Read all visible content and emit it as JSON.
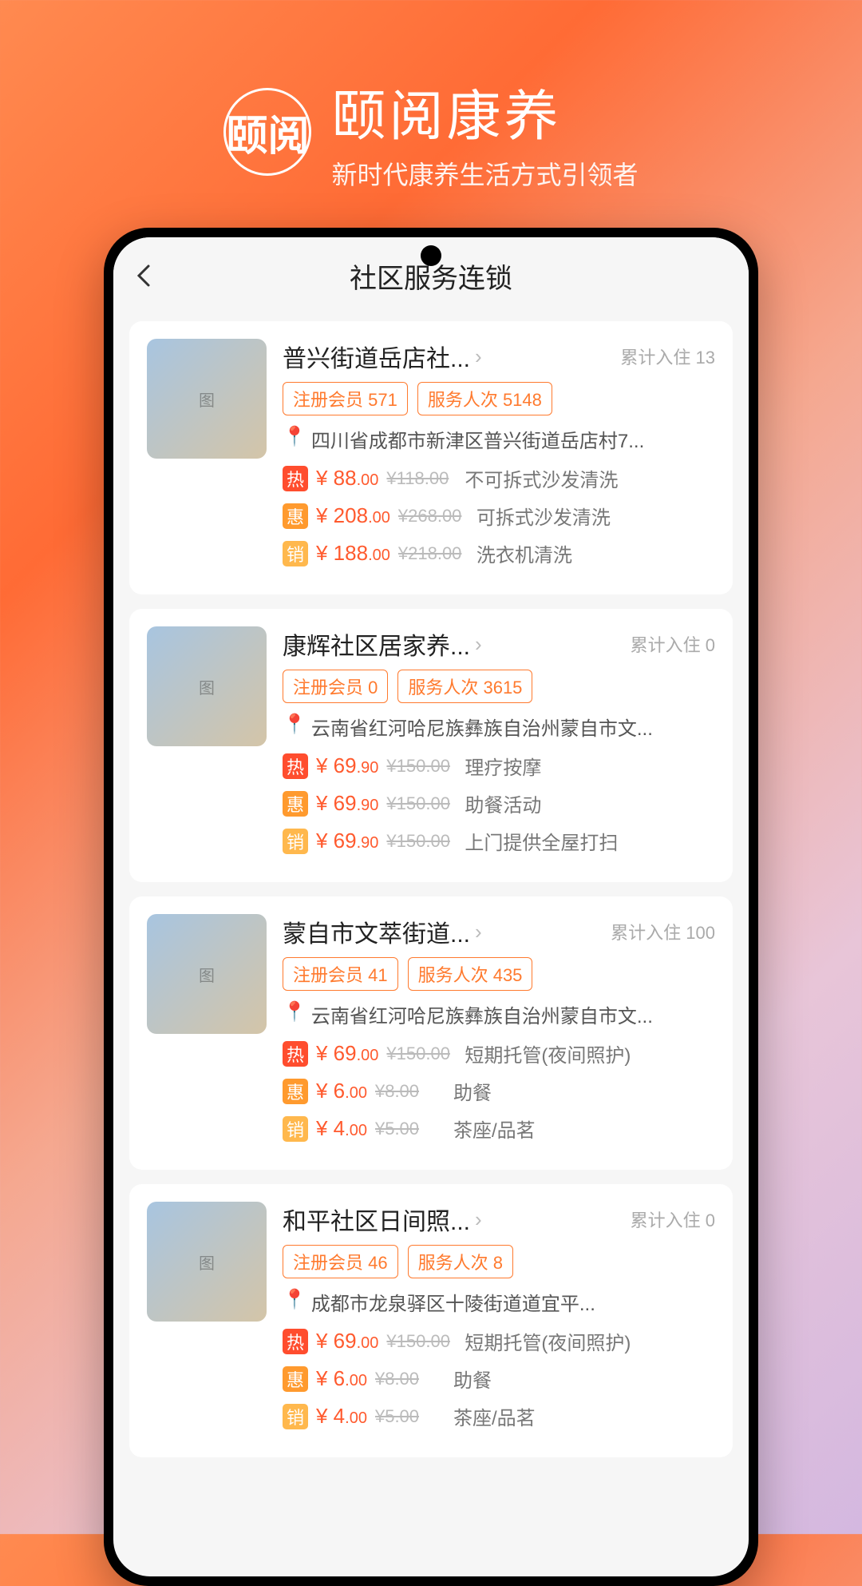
{
  "brand": {
    "logo_text": "颐阅",
    "title": "颐阅康养",
    "subtitle": "新时代康养生活方式引领者"
  },
  "header": {
    "title": "社区服务连锁"
  },
  "tags": {
    "hot": "热",
    "hui": "惠",
    "xiao": "销"
  },
  "stat_label": "累计入住",
  "badge_member_label": "注册会员",
  "badge_service_label": "服务人次",
  "cards": [
    {
      "title": "普兴街道岳店社...",
      "stat": "13",
      "members": "571",
      "service_count": "5148",
      "address": "四川省成都市新津区普兴街道岳店村7...",
      "services": [
        {
          "tag": "hot",
          "price": "88",
          "price_dec": ".00",
          "old": "¥118.00",
          "name": "不可拆式沙发清洗"
        },
        {
          "tag": "hui",
          "price": "208",
          "price_dec": ".00",
          "old": "¥268.00",
          "name": "可拆式沙发清洗"
        },
        {
          "tag": "xiao",
          "price": "188",
          "price_dec": ".00",
          "old": "¥218.00",
          "name": "洗衣机清洗"
        }
      ]
    },
    {
      "title": "康辉社区居家养...",
      "stat": "0",
      "members": "0",
      "service_count": "3615",
      "address": "云南省红河哈尼族彝族自治州蒙自市文...",
      "services": [
        {
          "tag": "hot",
          "price": "69",
          "price_dec": ".90",
          "old": "¥150.00",
          "name": "理疗按摩"
        },
        {
          "tag": "hui",
          "price": "69",
          "price_dec": ".90",
          "old": "¥150.00",
          "name": "助餐活动"
        },
        {
          "tag": "xiao",
          "price": "69",
          "price_dec": ".90",
          "old": "¥150.00",
          "name": "上门提供全屋打扫"
        }
      ]
    },
    {
      "title": "蒙自市文萃街道...",
      "stat": "100",
      "members": "41",
      "service_count": "435",
      "address": "云南省红河哈尼族彝族自治州蒙自市文...",
      "services": [
        {
          "tag": "hot",
          "price": "69",
          "price_dec": ".00",
          "old": "¥150.00",
          "name": "短期托管(夜间照护)"
        },
        {
          "tag": "hui",
          "price": "6",
          "price_dec": ".00",
          "old": "¥8.00",
          "name": "助餐"
        },
        {
          "tag": "xiao",
          "price": "4",
          "price_dec": ".00",
          "old": "¥5.00",
          "name": "茶座/品茗"
        }
      ]
    },
    {
      "title": "和平社区日间照...",
      "stat": "0",
      "members": "46",
      "service_count": "8",
      "address": "成都市龙泉驿区十陵街道道宜平...",
      "services": [
        {
          "tag": "hot",
          "price": "69",
          "price_dec": ".00",
          "old": "¥150.00",
          "name": "短期托管(夜间照护)"
        },
        {
          "tag": "hui",
          "price": "6",
          "price_dec": ".00",
          "old": "¥8.00",
          "name": "助餐"
        },
        {
          "tag": "xiao",
          "price": "4",
          "price_dec": ".00",
          "old": "¥5.00",
          "name": "茶座/品茗"
        }
      ]
    }
  ]
}
